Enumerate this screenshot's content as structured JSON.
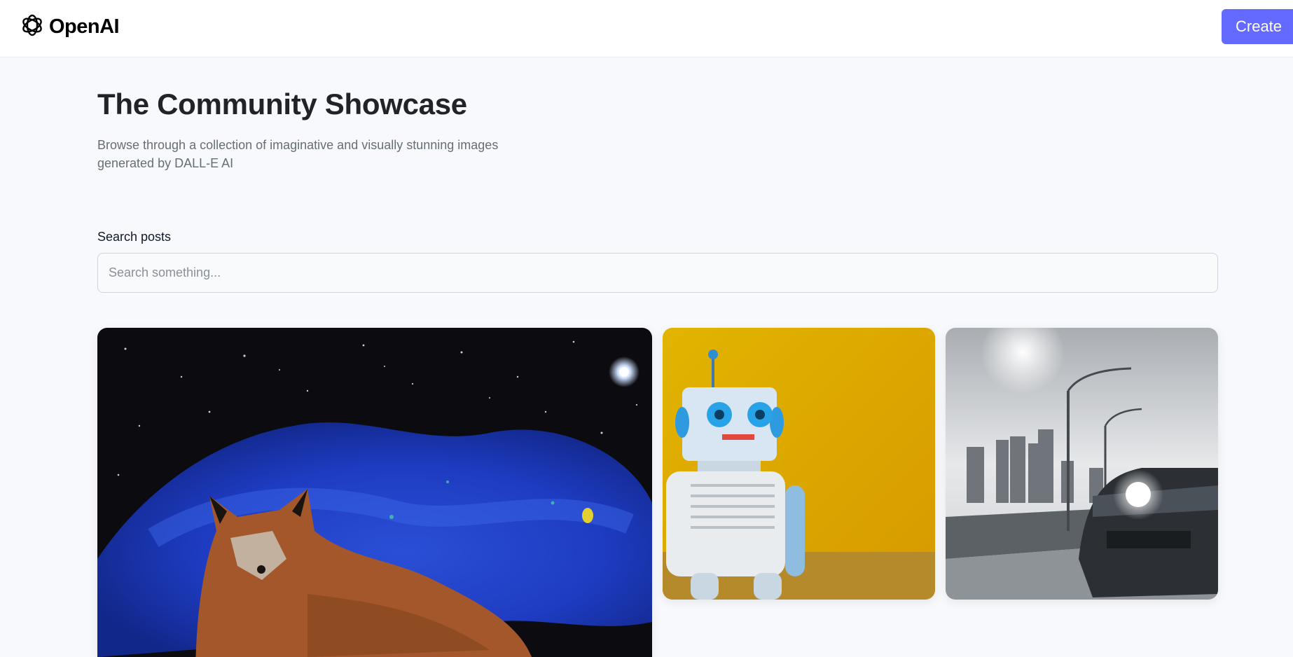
{
  "header": {
    "logo_text": "OpenAI",
    "logo_icon": "openai-logo-icon",
    "create_label": "Create",
    "accent_color": "#6469ff"
  },
  "hero": {
    "title": "The Community Showcase",
    "subtitle": "Browse through a collection of imaginative and visually stunning images generated by DALL-E AI"
  },
  "search": {
    "label": "Search posts",
    "placeholder": "Search something...",
    "value": ""
  },
  "gallery": {
    "cards": [
      {
        "subject": "fox in a starry blue nebula"
      },
      {
        "subject": "robot toy against yellow wall"
      },
      {
        "subject": "car on highway with city skyline"
      }
    ]
  }
}
